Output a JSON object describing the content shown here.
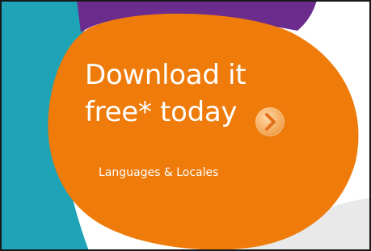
{
  "promo": {
    "headline_line1": "Download it",
    "headline_line2": "free* today",
    "arrow_icon": "chevron-right-circle-icon",
    "languages_link": "Languages & Locales"
  },
  "colors": {
    "orange_blob": "#ee7b0a",
    "teal_shape": "#1ea4b6",
    "purple_shape": "#6b2c8e",
    "background": "#ffffff",
    "text": "#ffffff"
  }
}
